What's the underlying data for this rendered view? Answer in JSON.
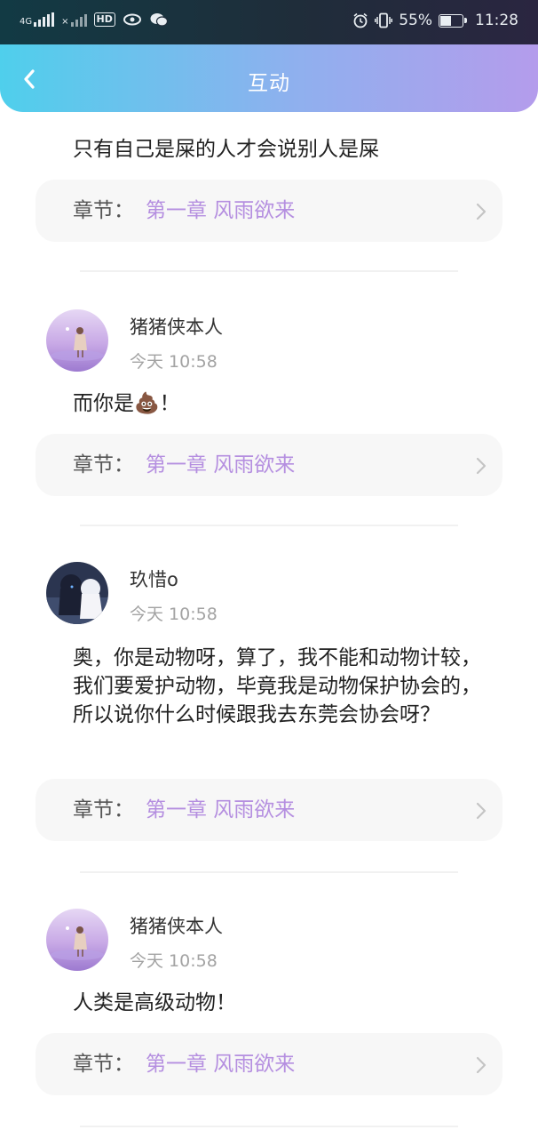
{
  "status_bar": {
    "network_1": "4G",
    "network_1_sub": "4G",
    "hd_badge": "HD",
    "battery_percent": "55%",
    "battery_level": 0.55,
    "time": "11:28"
  },
  "header": {
    "title": "互动",
    "gradient_start": "#4fcfec",
    "gradient_end": "#b49cec"
  },
  "chapter_label": "章节：",
  "feed": [
    {
      "partial": true,
      "content": "只有自己是屎的人才会说别人是屎",
      "chapter": "第一章 风雨欲来"
    },
    {
      "username": "猪猪侠本人",
      "time": "今天 10:58",
      "content": "而你是💩！",
      "chapter": "第一章 风雨欲来"
    },
    {
      "username": "玖惜o",
      "time": "今天 10:58",
      "content": "奥，你是动物呀，算了，我不能和动物计较，我们要爱护动物，毕竟我是动物保护协会的，所以说你什么时候跟我去东莞会协会呀？",
      "chapter": "第一章 风雨欲来"
    },
    {
      "username": "猪猪侠本人",
      "time": "今天 10:58",
      "content": "人类是高级动物！",
      "chapter": "第一章 风雨欲来"
    }
  ],
  "colors": {
    "chapter_value": "#b58fe0",
    "time_text": "#a3a3a3"
  }
}
